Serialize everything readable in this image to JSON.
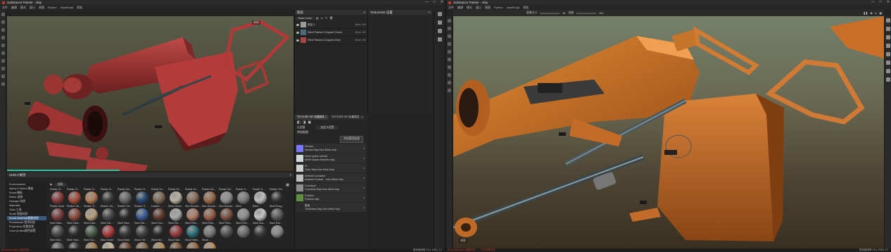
{
  "left": {
    "title": "Substance Painter - ship",
    "window_buttons": [
      "—",
      "□",
      "✕"
    ],
    "menu": [
      "文件",
      "编辑",
      "模式",
      "窗口",
      "视图",
      "Python",
      "JavaScript",
      "帮助"
    ],
    "viewport_label": "材质",
    "layers_panel": {
      "title": "图层",
      "blend_mode": "Base Color",
      "layers": [
        {
          "name": "图层 1",
          "blend": "Norm 100",
          "color": "#9a9a9a"
        },
        {
          "name": "Steel Painted Chipped Green",
          "blend": "Norm 100",
          "color": "#4b6a7a"
        },
        {
          "name": "Steel Painted Chipped Dirty",
          "blend": "Norm 100",
          "color": "#a84646"
        }
      ]
    },
    "texset_panel": {
      "title": "TextureSet 设置",
      "tab": "properties"
    },
    "properties_panel": {
      "tabs": [
        "TEXTURE SET设置属性 ×",
        "TEXTURE SET设置属性 - ×"
      ],
      "section_title": "烘焙贴图",
      "filter": "过滤器",
      "dropdown": "自定义设置",
      "bake_button": "烘焙模型贴图",
      "effects": [
        {
          "t1": "Normal",
          "t2": "Normal Map from Mesh ship",
          "color": "#7a77ff"
        },
        {
          "t1": "World space normal",
          "t2": "World Space Normals ship",
          "color": "#cfd8d8"
        },
        {
          "t1": "ID",
          "t2": "Color Map from Mesh ship",
          "color": "#d0d0d0"
        },
        {
          "t1": "Ambient occlusion",
          "t2": "Ambient Occlusi... from Mesh ship",
          "color": "#bdbdbd"
        },
        {
          "t1": "Curvature",
          "t2": "Curvature Map from Mesh ship",
          "color": "#8d8d8d"
        },
        {
          "t1": "Position",
          "t2": "Position ship",
          "color": "#5f8e3e"
        },
        {
          "t1": "厚度",
          "t2": "Thickness Map from Mesh ship",
          "color": "#2b2b2b"
        }
      ]
    },
    "shelf": {
      "title": "SHELF展架",
      "search_placeholder": "搜索",
      "categories": [
        "Environments",
        "Alpha & Stencil 模板",
        "Smart 模板",
        "Filters 滤镜",
        "Grunges 材质",
        "Materials",
        "Tools 工具",
        "Smart 智能材质",
        "Smart Materials智能材质",
        "Procedurals 程序纹理",
        "Projections 投影纹理",
        "Color profiles颜色配置"
      ],
      "selected_category": "Smart Materials智能材质",
      "items": [
        {
          "n": "Plastic Gl...",
          "c": "#8a3b3b"
        },
        {
          "n": "Plastic Gl...",
          "c": "#a84d3b"
        },
        {
          "n": "Plastic Gl...",
          "c": "#b07a55"
        },
        {
          "n": "Plastic Gl...",
          "c": "#3a3a3a"
        },
        {
          "n": "Plastic Dia...",
          "c": "#666"
        },
        {
          "n": "Plastic Gl...",
          "c": "#28466f"
        },
        {
          "n": "Plastic Ho...",
          "c": "#7d6a55"
        },
        {
          "n": "Plastic Ho...",
          "c": "#b9b0a3"
        },
        {
          "n": "Plastic Ho...",
          "c": "#8b6e5a"
        },
        {
          "n": "Plastic Sof...",
          "c": "#9a6b4a"
        },
        {
          "n": "Plastic Sof...",
          "c": "#8f8f8f"
        },
        {
          "n": "Plastic Tr...",
          "c": "#7b7b7b"
        },
        {
          "n": "Plastic Tr...",
          "c": "#bcbcbc"
        },
        {
          "n": "Rubber Tire",
          "c": "#333"
        },
        {
          "n": "Plastic Great",
          "c": "#7e4040"
        },
        {
          "n": "Rubber Zis...",
          "c": "#8c4d3e"
        },
        {
          "n": "Rubber Ti...",
          "c": "#b9a07e"
        },
        {
          "n": "Rubber Zis...",
          "c": "#4a4a4a"
        },
        {
          "n": "Rubber Fle...",
          "c": "#2f2f2f"
        },
        {
          "n": "Rubber Ti...",
          "c": "#3b5b93"
        },
        {
          "n": "Leather ...",
          "c": "#5e3b2b"
        },
        {
          "n": "Silver Armor",
          "c": "#a9a9a9"
        },
        {
          "n": "Skin Human...",
          "c": "#b07b66"
        },
        {
          "n": "Skin Human...",
          "c": "#9a6048"
        },
        {
          "n": "Skin Human...",
          "c": "#7c5445"
        },
        {
          "n": "Steel",
          "c": "#8e8e8e"
        },
        {
          "n": "Steel ...",
          "c": "#c4c4c4"
        },
        {
          "n": "Steel Roug...",
          "c": "#5a5a5a"
        },
        {
          "n": "Steel Dark...",
          "c": "#4c4c4c"
        },
        {
          "n": "Steel Dark...",
          "c": "#2e2e2e"
        },
        {
          "n": "Steel Dark...",
          "c": "#4a5d4a"
        },
        {
          "n": "Steel Dar...",
          "c": "#b03b3b"
        },
        {
          "n": "Steel Dark...",
          "c": "#3b3b3b"
        },
        {
          "n": "Steel Dirt...",
          "c": "#444"
        },
        {
          "n": "Steel Gun...",
          "c": "#2b2b2b"
        },
        {
          "n": "Steel Pai...",
          "c": "#9a3c3c"
        },
        {
          "n": "Steel Pain...",
          "c": "#2f6f7a"
        },
        {
          "n": "Steel Pain...",
          "c": "#7a7a7a"
        },
        {
          "n": "Steel Pain...",
          "c": "#555"
        },
        {
          "n": "Steel Pain...",
          "c": "#6e6e6e"
        },
        {
          "n": "Steel Sca...",
          "c": "#3d3d3d"
        },
        {
          "n": "Steel Rou...",
          "c": "#888"
        },
        {
          "n": "Steel Stai...",
          "c": "#5a5a5a"
        },
        {
          "n": "Steel Vara...",
          "c": "#333"
        },
        {
          "n": "Steel Sco...",
          "c": "#a57a4a"
        },
        {
          "n": "Wax Cream",
          "c": "#c9b89a"
        },
        {
          "n": "Wood Bark",
          "c": "#6e4a33"
        },
        {
          "n": "Wood Old",
          "c": "#8a6a4a"
        },
        {
          "n": "Wood Ba...",
          "c": "#b58a5a"
        },
        {
          "n": "Wood Wal...",
          "c": "#7d5335"
        },
        {
          "n": "Wood Walu...",
          "c": "#9a6b42"
        },
        {
          "n": "Wood ...",
          "c": "#b8905f"
        },
        {
          "n": "",
          "c": "#232323"
        },
        {
          "n": "",
          "c": "#232323"
        },
        {
          "n": "",
          "c": "#232323"
        },
        {
          "n": "",
          "c": "#232323"
        }
      ]
    },
    "status_error": "[AssetManager] 读取失败......",
    "status_right": "显存使用率 1%  |  1GB  |  2.2"
  },
  "right": {
    "title": "Substance Painter - ship",
    "window_buttons": [
      "—",
      "□",
      "✕"
    ],
    "menu": [
      "文件",
      "编辑",
      "模式",
      "窗口",
      "视图",
      "Python",
      "JavaScript",
      "帮助"
    ],
    "toolbar": {
      "size_label": "画笔大小",
      "size_value": "28",
      "flow_label": "流量",
      "flow_value": "100"
    },
    "viewport_label": "材质",
    "status_error": "[AssetManager] 读取失败 ...... 无法读取文件",
    "status_right": "显存使用率 1%  |  1GB  |  2.2"
  }
}
